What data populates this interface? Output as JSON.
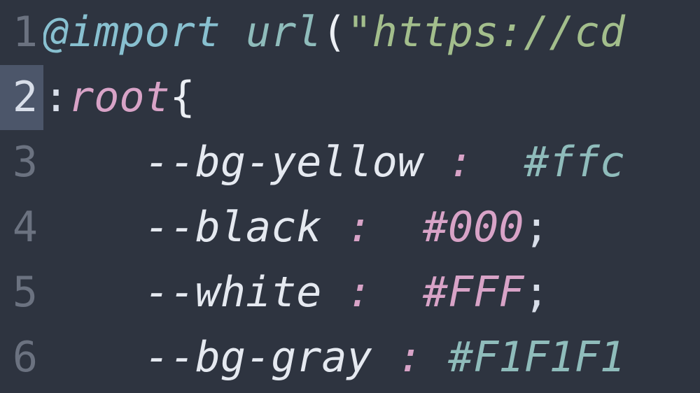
{
  "editor": {
    "active_line": 2,
    "lines": [
      {
        "num": "1",
        "tokens": [
          {
            "cls": "tok-keyword",
            "text": "@import"
          },
          {
            "cls": "",
            "text": " "
          },
          {
            "cls": "tok-func",
            "text": "url"
          },
          {
            "cls": "tok-paren",
            "text": "("
          },
          {
            "cls": "tok-string",
            "text": "\"https://cd"
          }
        ]
      },
      {
        "num": "2",
        "tokens": [
          {
            "cls": "tok-punct",
            "text": ":"
          },
          {
            "cls": "tok-selector",
            "text": "root"
          },
          {
            "cls": "tok-brace",
            "text": "{"
          }
        ]
      },
      {
        "num": "3",
        "tokens": [
          {
            "cls": "tok-var",
            "text": "    --bg-yellow "
          },
          {
            "cls": "tok-colon",
            "text": ":"
          },
          {
            "cls": "tok-var",
            "text": "  "
          },
          {
            "cls": "tok-hex",
            "text": "#ffc"
          }
        ]
      },
      {
        "num": "4",
        "tokens": [
          {
            "cls": "tok-var",
            "text": "    --black "
          },
          {
            "cls": "tok-colon",
            "text": ":"
          },
          {
            "cls": "tok-var",
            "text": "  "
          },
          {
            "cls": "tok-hex-alt",
            "text": "#000"
          },
          {
            "cls": "tok-punct",
            "text": ";"
          }
        ]
      },
      {
        "num": "5",
        "tokens": [
          {
            "cls": "tok-var",
            "text": "    --white "
          },
          {
            "cls": "tok-colon",
            "text": ":"
          },
          {
            "cls": "tok-var",
            "text": "  "
          },
          {
            "cls": "tok-hex-alt",
            "text": "#FFF"
          },
          {
            "cls": "tok-punct",
            "text": ";"
          }
        ]
      },
      {
        "num": "6",
        "tokens": [
          {
            "cls": "tok-var",
            "text": "    --bg-gray "
          },
          {
            "cls": "tok-colon",
            "text": ":"
          },
          {
            "cls": "tok-var",
            "text": " "
          },
          {
            "cls": "tok-hex",
            "text": "#F1F1F1"
          }
        ]
      }
    ]
  }
}
